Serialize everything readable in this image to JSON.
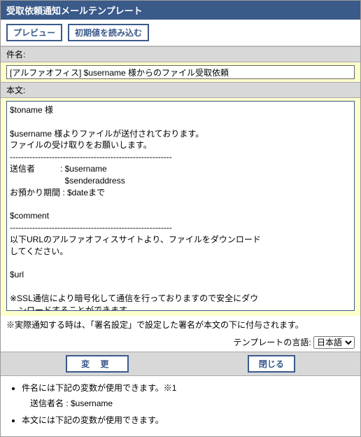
{
  "title": "受取依頼通知メールテンプレート",
  "toolbar": {
    "preview": "プレビュー",
    "load_defaults": "初期値を読み込む"
  },
  "labels": {
    "subject": "件名:",
    "body": "本文:"
  },
  "subject_value": "[アルファオフィス] $username 様からのファイル受取依頼",
  "body_value": "$toname 様\n\n$username 様よりファイルが送付されております。\nファイルの受け取りをお願いします。\n----------------------------------------------------------\n送信者　　　: $username\n　　　　　　  $senderaddress\nお預かり期間 : $dateまで\n\n$comment\n----------------------------------------------------------\n以下URLのアルファオフィスサイトより、ファイルをダウンロード\nしてください。\n\n$url\n\n※SSL通信により暗号化して通信を行っておりますので安全にダウ\n　ンロードすることができます。\n----------------------------------------------------------\n・お預かり期間を過ぎたファイルや削除されたファイルはダウン\n　ロードすることができません。送信者様に再送をご依頼ください。\n・ログイン時にパスワードを求められた場合は、送信者様にご確認\n　ください。\n・ダウンロード方法や機能については下記ページをご参照ください。",
  "note": "※実際通知する時は、「署名設定」で設定した署名が本文の下に付与されます。",
  "lang_label": "テンプレートの言語:",
  "lang_value": "日本語",
  "actions": {
    "change": "変 更",
    "close": "閉じる"
  },
  "help": {
    "item1": "件名には下記の変数が使用できます。※1",
    "item1_sub": "送信者名 : $username",
    "item2": "本文には下記の変数が使用できます。"
  }
}
